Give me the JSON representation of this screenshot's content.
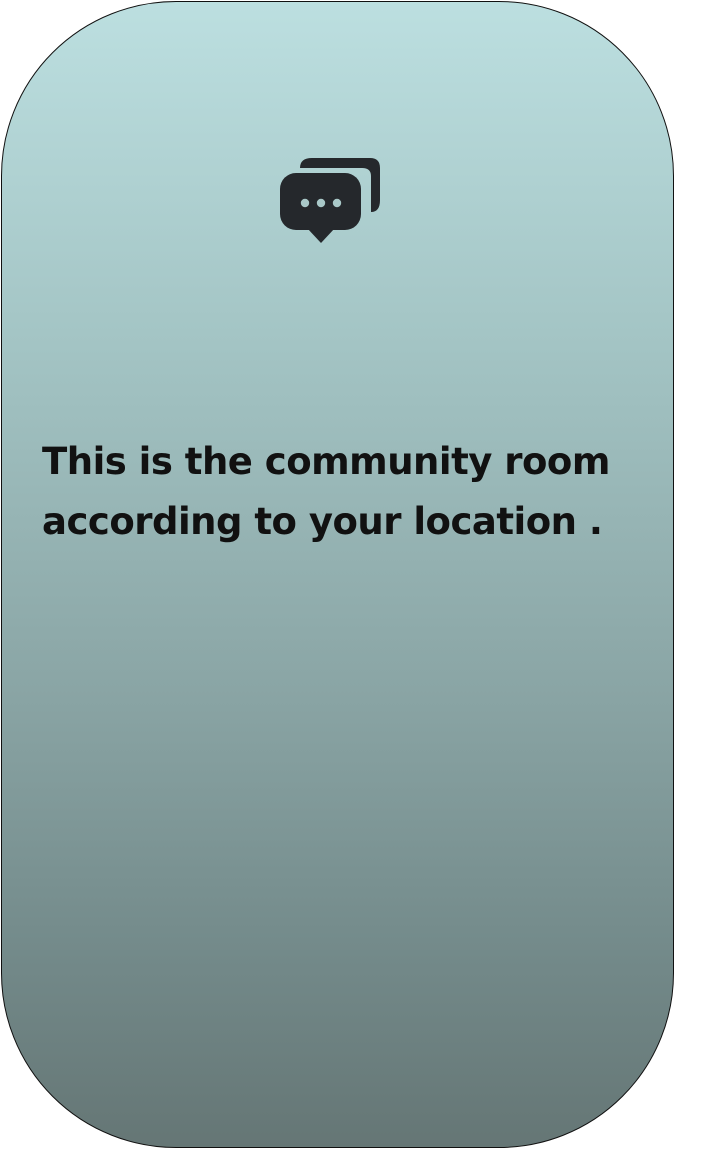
{
  "community_card": {
    "icon": "chat-bubbles-icon",
    "message": "This is the community room according to your location ."
  },
  "colors": {
    "gradient_top": "#bcdfe0",
    "gradient_bottom": "#657675",
    "icon": "#25282c",
    "text": "#111111"
  }
}
